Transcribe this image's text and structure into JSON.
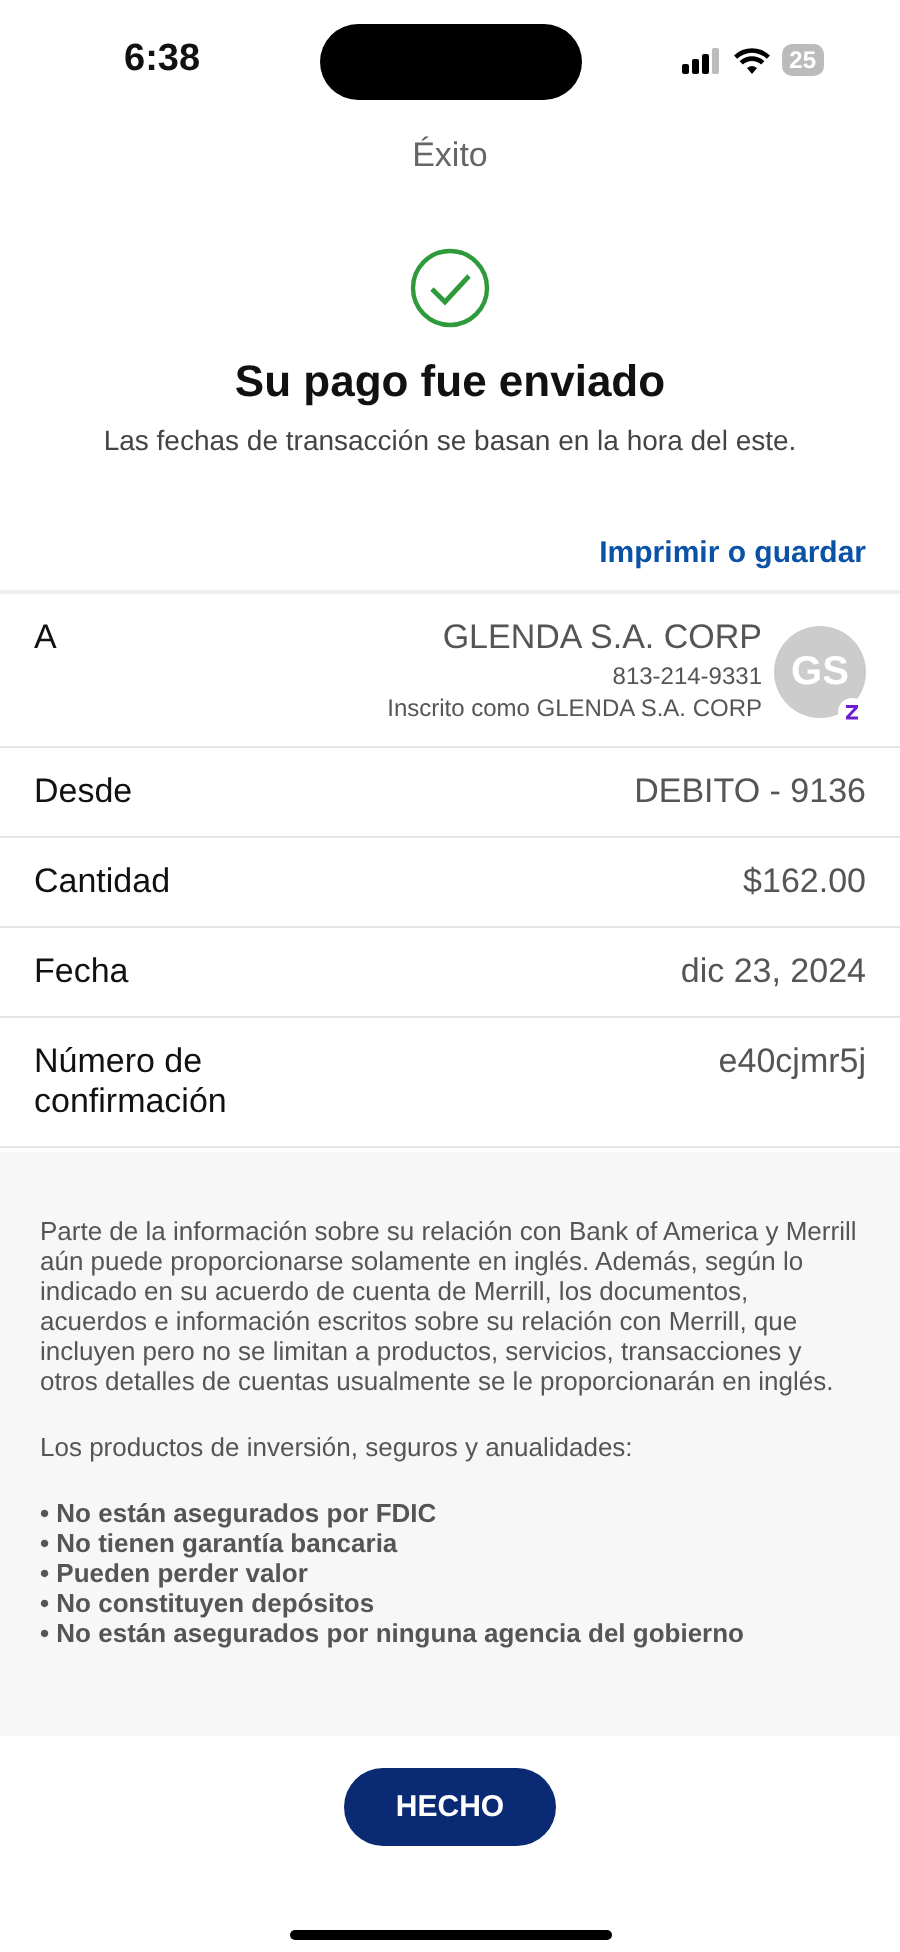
{
  "status_bar": {
    "time": "6:38",
    "battery": "25"
  },
  "title": "Éxito",
  "heading": "Su pago fue enviado",
  "subtitle": "Las fechas de transacción se basan en la hora del este.",
  "print_link": "Imprimir o guardar",
  "payee": {
    "label": "A",
    "name": "GLENDA S.A. CORP",
    "phone": "813-214-9331",
    "enrolled": "Inscrito como GLENDA S.A. CORP",
    "initials": "GS"
  },
  "details": [
    {
      "label": "Desde",
      "value": "DEBITO - 9136"
    },
    {
      "label": "Cantidad",
      "value": "$162.00"
    },
    {
      "label": "Fecha",
      "value": "dic 23, 2024"
    },
    {
      "label": "Número de confirmación",
      "value": "e40cjmr5j"
    }
  ],
  "disclosure": {
    "paragraphs": [
      "Parte de la información sobre su relación con Bank of America y Merrill aún puede proporcionarse solamente en inglés. Además, según lo indicado en su acuerdo de cuenta de Merrill, los documentos, acuerdos e información escritos sobre su relación con Merrill, que incluyen pero no se limitan a productos, servicios, transacciones y otros detalles de cuentas usualmente se le proporcionarán en inglés.",
      "Los productos de inversión, seguros y anualidades:"
    ],
    "bullets": [
      "• No están asegurados por FDIC",
      "• No tienen garantía bancaria",
      "• Pueden perder valor",
      "• No constituyen depósitos",
      "• No están asegurados por ninguna agencia del gobierno"
    ]
  },
  "done_button": "HECHO"
}
